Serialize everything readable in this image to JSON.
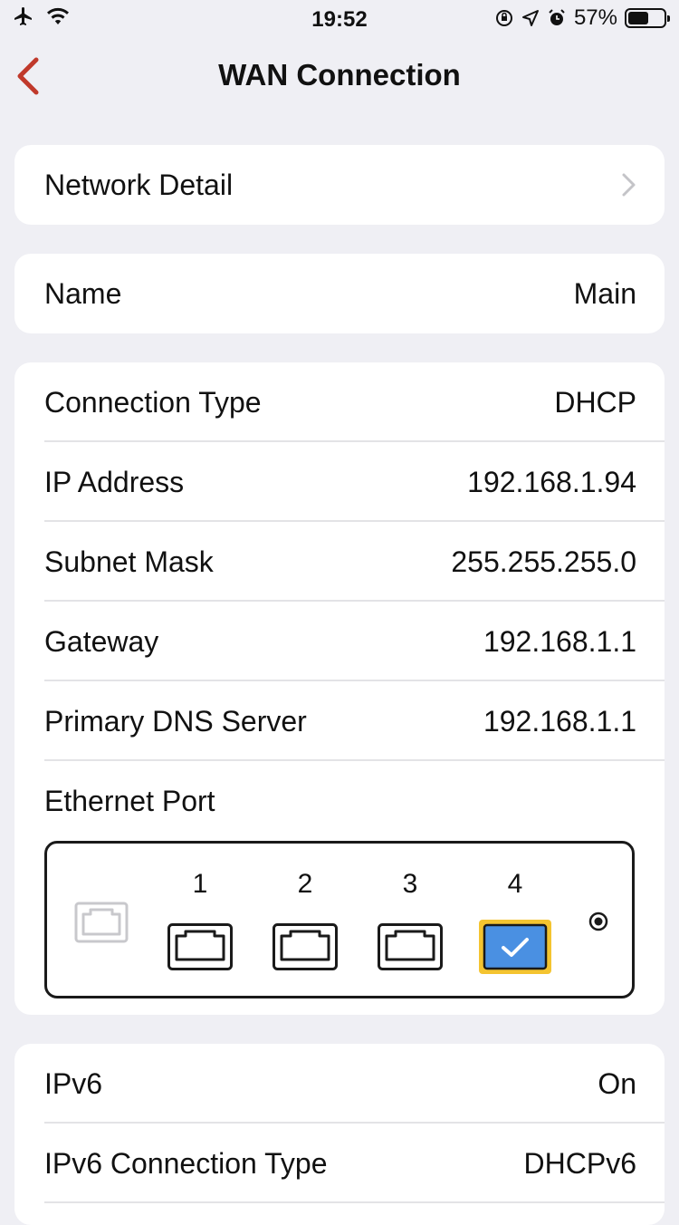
{
  "status_bar": {
    "time": "19:52",
    "battery_percent_label": "57%",
    "battery_level": 0.57,
    "left_icons": [
      "airplane-icon",
      "wifi-icon"
    ],
    "right_icons": [
      "orientation-lock-icon",
      "location-arrow-icon",
      "alarm-icon"
    ]
  },
  "nav": {
    "title": "WAN Connection",
    "back_icon": "chevron-left-icon",
    "accent_color": "#c0392b"
  },
  "network_detail": {
    "label": "Network Detail"
  },
  "name": {
    "label": "Name",
    "value": "Main"
  },
  "details": [
    {
      "label": "Connection Type",
      "value": "DHCP"
    },
    {
      "label": "IP Address",
      "value": "192.168.1.94"
    },
    {
      "label": "Subnet Mask",
      "value": "255.255.255.0"
    },
    {
      "label": "Gateway",
      "value": "192.168.1.1"
    },
    {
      "label": "Primary DNS Server",
      "value": "192.168.1.1"
    }
  ],
  "ethernet": {
    "label": "Ethernet Port",
    "ports": [
      "1",
      "2",
      "3",
      "4"
    ],
    "selected_port": "4",
    "selected_color": "#4a90e2",
    "highlight_color": "#f4c430"
  },
  "ipv6": [
    {
      "label": "IPv6",
      "value": "On"
    },
    {
      "label": "IPv6 Connection Type",
      "value": "DHCPv6"
    }
  ]
}
